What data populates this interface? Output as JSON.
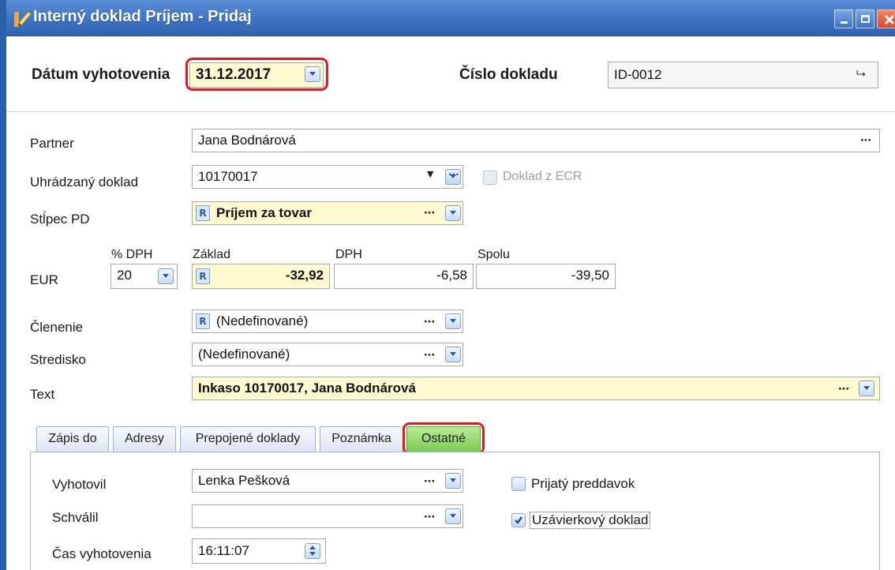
{
  "window": {
    "title": "Interný doklad Príjem - Pridaj"
  },
  "header": {
    "date_label": "Dátum vyhotovenia",
    "date_value": "31.12.2017",
    "docnum_label": "Číslo dokladu",
    "docnum_value": "ID-0012"
  },
  "form": {
    "partner_label": "Partner",
    "partner_value": "Jana Bodnárová",
    "paid_doc_label": "Uhrádzaný doklad",
    "paid_doc_value": "10170017",
    "ecr_label": "Doklad z ECR",
    "column_label": "Stĺpec PD",
    "column_value": "Príjem za tovar",
    "currency_label": "EUR",
    "vat_pct_header": "% DPH",
    "vat_pct_value": "20",
    "base_header": "Základ",
    "base_value": "-32,92",
    "vat_header": "DPH",
    "vat_value": "-6,58",
    "total_header": "Spolu",
    "total_value": "-39,50",
    "division_label": "Členenie",
    "division_value": "(Nedefinované)",
    "center_label": "Stredisko",
    "center_value": "(Nedefinované)",
    "text_label": "Text",
    "text_value": "Inkaso 10170017, Jana Bodnárová",
    "r_badge": "R"
  },
  "tabs": [
    "Zápis do",
    "Adresy",
    "Prepojené doklady",
    "Poznámka",
    "Ostatné"
  ],
  "other_tab": {
    "created_by_label": "Vyhotovil",
    "created_by_value": "Lenka Pešková",
    "approved_label": "Schválil",
    "approved_value": "",
    "time_label": "Čas vyhotovenia",
    "time_value": "16:11:07",
    "advance_label": "Prijatý preddavok",
    "advance_checked": false,
    "closing_label": "Uzávierkový doklad",
    "closing_checked": true
  },
  "colors": {
    "titlebar": "#3f74c4",
    "highlight": "#fffbd0",
    "active_tab": "#93d76a",
    "ring": "#e11b1b"
  },
  "icons": [
    "pencil-icon",
    "minimize-icon",
    "maximize-icon",
    "close-icon",
    "dropdown-icon",
    "ellipsis-icon",
    "spin-icon",
    "checkbox-icon",
    "go-icon"
  ]
}
